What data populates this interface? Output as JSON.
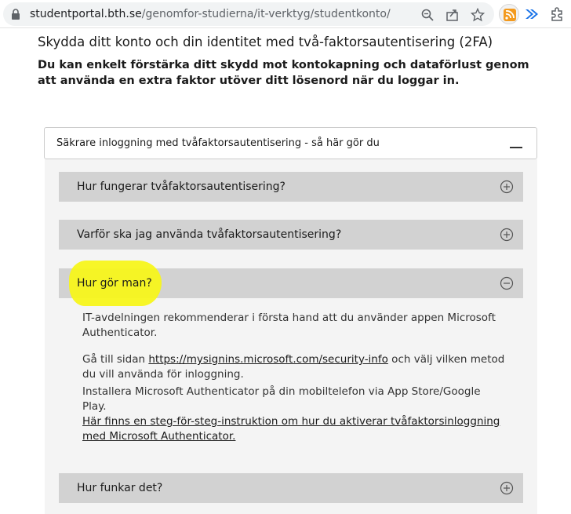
{
  "browser": {
    "url_host": "studentportal.bth.se",
    "url_path": "/genomfor-studierna/it-verktyg/studentkonto/",
    "icons": [
      "lock-icon",
      "zoom-icon",
      "share-icon",
      "bookmark-star-icon",
      "rss-extension-icon",
      "arrow-extension-icon",
      "puzzle-extension-icon"
    ]
  },
  "page": {
    "heading": "Skydda ditt konto och din identitet med två-faktorsautentisering (2FA)",
    "intro": "Du kan enkelt förstärka ditt skydd mot kontokapning och dataförlust genom att använda en extra faktor utöver ditt lösenord när du loggar in."
  },
  "accordion": {
    "title": "Säkrare inloggning med tvåfaktorsautentisering - så här gör du",
    "toggle_symbol": "—",
    "items": [
      {
        "label": "Hur fungerar tvåfaktorsautentisering?",
        "state": "collapsed",
        "icon": "plus-circle-icon"
      },
      {
        "label": "Varför ska jag använda tvåfaktorsautentisering?",
        "state": "collapsed",
        "icon": "plus-circle-icon"
      },
      {
        "label": "Hur gör man?",
        "state": "expanded",
        "icon": "minus-circle-icon",
        "highlighted": true
      },
      {
        "label": "Hur funkar det?",
        "state": "collapsed",
        "icon": "plus-circle-icon"
      }
    ],
    "expanded_content": {
      "p1": "IT-avdelningen rekommenderar i första hand att du använder appen Microsoft Authenticator.",
      "p2_before": "Gå till sidan ",
      "p2_link": "https://mysignins.microsoft.com/security-info",
      "p2_after": " och välj vilken metod du vill använda för inloggning.",
      "p3": "Installera Microsoft Authenticator på din mobiltelefon via App Store/Google Play.",
      "p4_link": "Här finns en steg-för-steg-instruktion om hur du aktiverar tvåfaktorsinloggning med Microsoft Authenticator."
    }
  },
  "colors": {
    "header_bg": "#d2d2d2",
    "panel_bg": "#f4f4f4",
    "highlight": "#f7f51b"
  }
}
